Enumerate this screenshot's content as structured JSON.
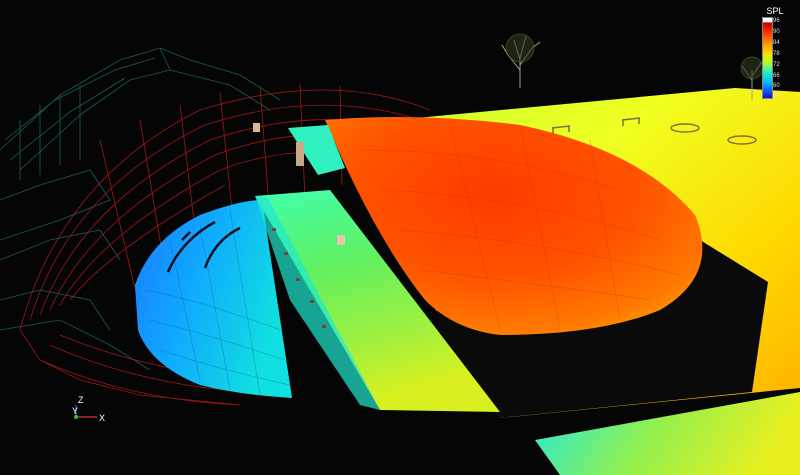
{
  "legend": {
    "title": "SPL",
    "ticks": [
      "96",
      "90",
      "84",
      "78",
      "72",
      "66",
      "60",
      "54"
    ]
  },
  "axes": {
    "z": "Z",
    "y": "Y",
    "x": "X"
  },
  "colors": {
    "background": "#050505",
    "spl_high": "#ff3a00",
    "spl_mid": "#ffe000",
    "spl_low": "#1060ff"
  }
}
